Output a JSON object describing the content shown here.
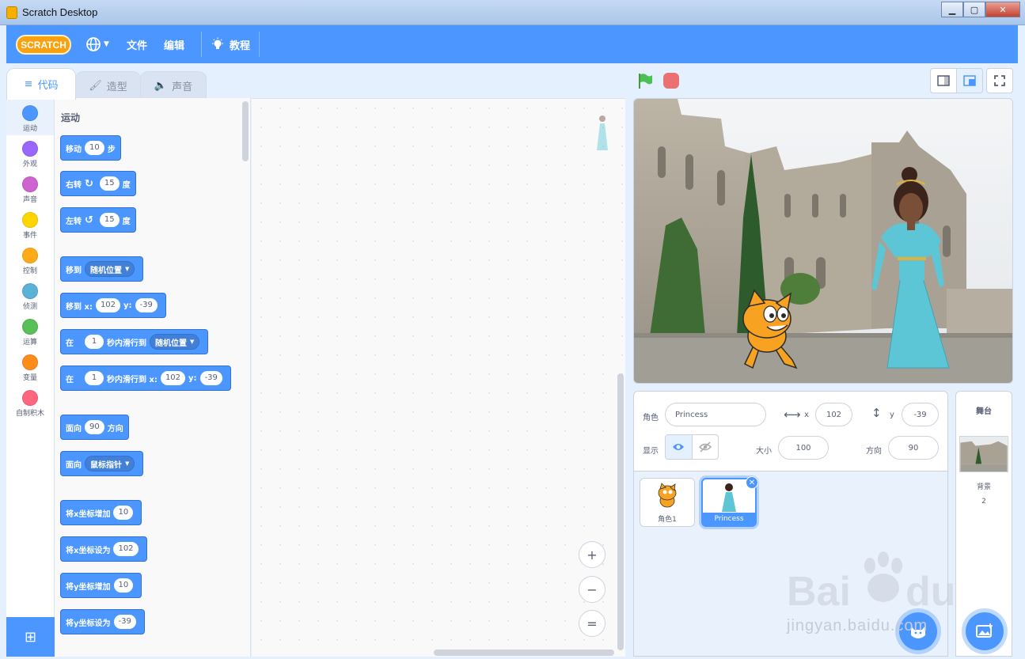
{
  "window": {
    "title": "Scratch Desktop"
  },
  "menubar": {
    "logo": "SCRATCH",
    "file": "文件",
    "edit": "编辑",
    "tutorials": "教程"
  },
  "tabs": [
    {
      "label": "代码"
    },
    {
      "label": "造型"
    },
    {
      "label": "声音"
    }
  ],
  "categories": [
    {
      "label": "运动",
      "color": "#4c97ff"
    },
    {
      "label": "外观",
      "color": "#9966ff"
    },
    {
      "label": "声音",
      "color": "#cf63cf"
    },
    {
      "label": "事件",
      "color": "#ffd500"
    },
    {
      "label": "控制",
      "color": "#ffab19"
    },
    {
      "label": "侦测",
      "color": "#5cb1d6"
    },
    {
      "label": "运算",
      "color": "#59c059"
    },
    {
      "label": "变量",
      "color": "#ff8c1a"
    },
    {
      "label": "自制积木",
      "color": "#ff6680"
    }
  ],
  "palette": {
    "section_title": "运动",
    "blocks": {
      "move": {
        "pre": "移动",
        "val": "10",
        "post": "步"
      },
      "turn_right": {
        "pre": "右转",
        "val": "15",
        "post": "度"
      },
      "turn_left": {
        "pre": "左转",
        "val": "15",
        "post": "度"
      },
      "goto": {
        "pre": "移到",
        "menu": "随机位置"
      },
      "goto_xy": {
        "pre": "移到 x:",
        "x": "102",
        "ylab": "y:",
        "y": "-39"
      },
      "glide": {
        "pre": "在",
        "val": "1",
        "mid": "秒内滑行到",
        "menu": "随机位置"
      },
      "glide_xy": {
        "pre": "在",
        "val": "1",
        "mid": "秒内滑行到 x:",
        "x": "102",
        "ylab": "y:",
        "y": "-39"
      },
      "point_dir": {
        "pre": "面向",
        "val": "90",
        "post": "方向"
      },
      "point_towards": {
        "pre": "面向",
        "menu": "鼠标指针"
      },
      "change_x": {
        "pre": "将x坐标增加",
        "val": "10"
      },
      "set_x": {
        "pre": "将x坐标设为",
        "val": "102"
      },
      "change_y": {
        "pre": "将y坐标增加",
        "val": "10"
      },
      "set_y": {
        "pre": "将y坐标设为",
        "val": "-39"
      }
    }
  },
  "zoom": {
    "in": "+",
    "out": "−",
    "reset": "="
  },
  "sprite_info": {
    "sprite_label": "角色",
    "sprite_name": "Princess",
    "x_label": "x",
    "x": "102",
    "y_label": "y",
    "y": "-39",
    "show_label": "显示",
    "size_label": "大小",
    "size": "100",
    "direction_label": "方向",
    "direction": "90"
  },
  "sprites": [
    {
      "name": "角色1"
    },
    {
      "name": "Princess"
    }
  ],
  "stage_pane": {
    "title": "舞台",
    "backdrop_label": "背景",
    "backdrop_count": "2"
  },
  "watermark": {
    "text": "jingyan.baidu.com"
  },
  "colors": {
    "accent": "#4c97ff",
    "motion": "#4c97ff",
    "stop": "#ec5959",
    "flag": "#4cbf56"
  }
}
